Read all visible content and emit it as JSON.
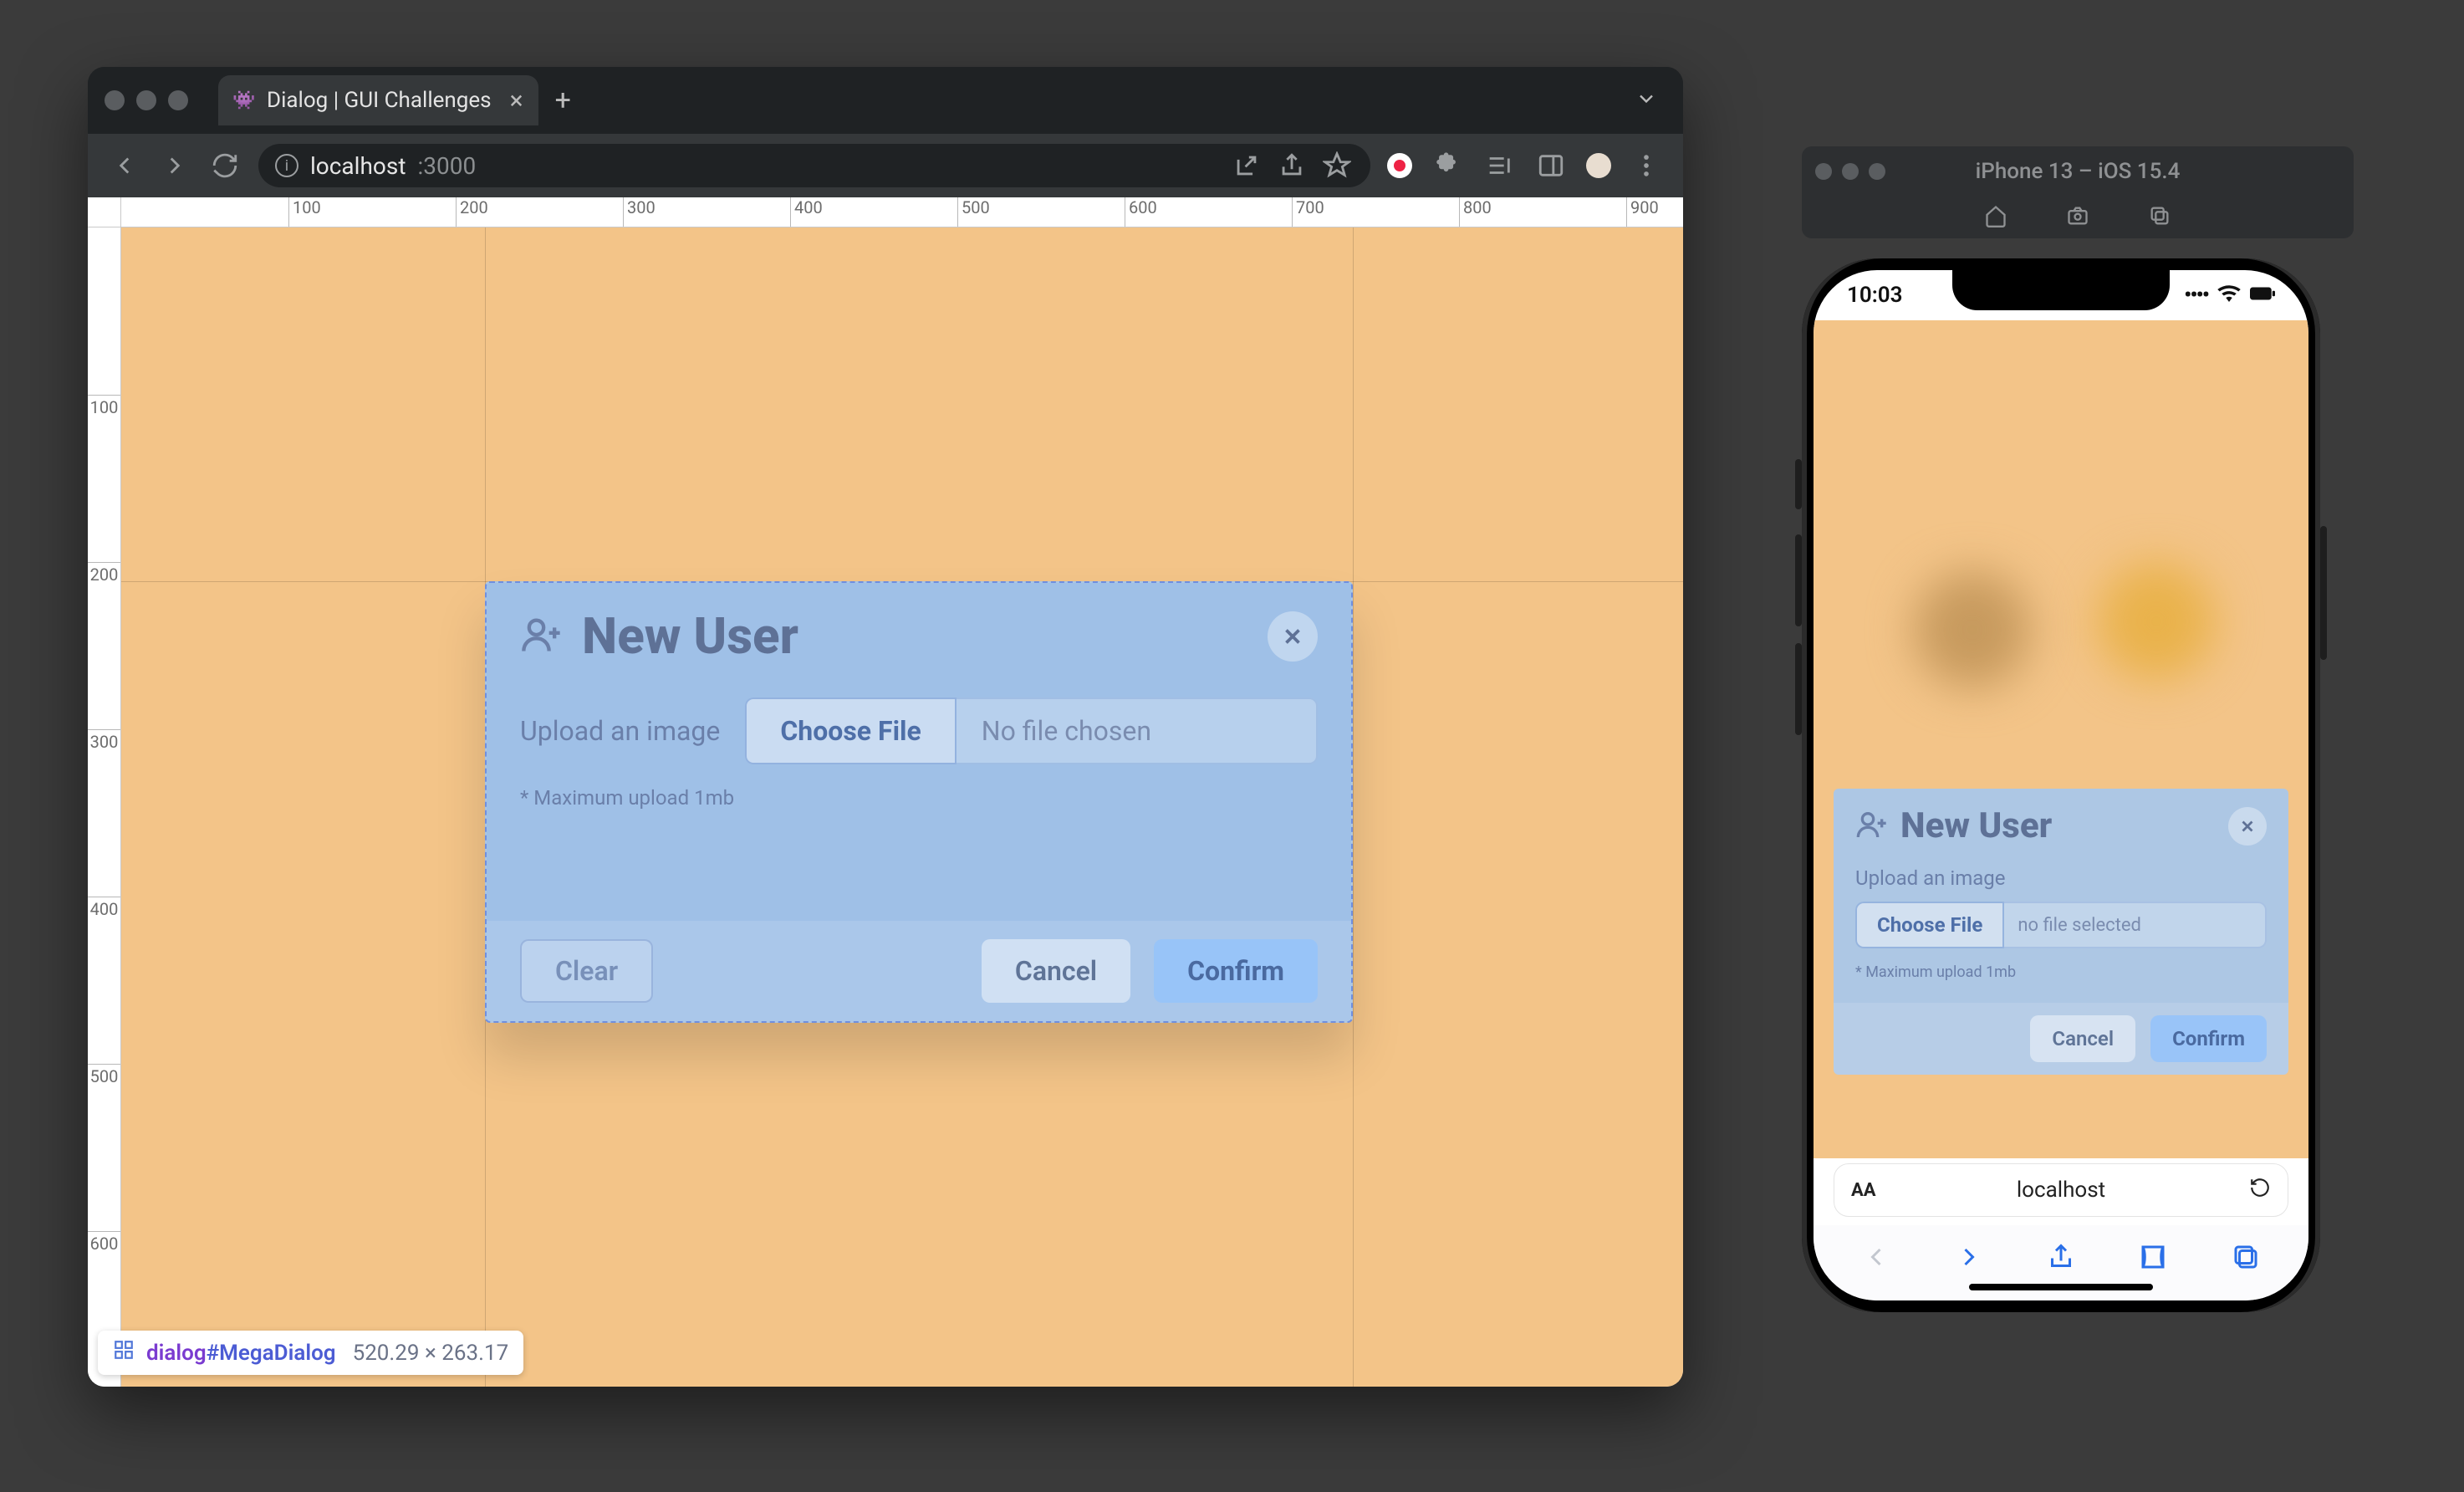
{
  "browser": {
    "tab_title": "Dialog | GUI Challenges",
    "url_host": "localhost",
    "url_port": ":3000",
    "ruler_h": [
      "100",
      "200",
      "300",
      "400",
      "500",
      "600",
      "700",
      "800",
      "900"
    ],
    "ruler_v": [
      "100",
      "200",
      "300",
      "400",
      "500",
      "600"
    ],
    "selector_tag": "dialog",
    "selector_id": "#MegaDialog",
    "selector_dim": "520.29 × 263.17"
  },
  "dialog": {
    "title": "New User",
    "upload_label": "Upload an image",
    "choose_file": "Choose File",
    "no_file": "No file chosen",
    "hint": "* Maximum upload 1mb",
    "clear": "Clear",
    "cancel": "Cancel",
    "confirm": "Confirm"
  },
  "simulator": {
    "title": "iPhone 13 – iOS 15.4",
    "clock": "10:03",
    "url": "localhost"
  },
  "dialog_mobile": {
    "title": "New User",
    "upload_label": "Upload an image",
    "choose_file": "Choose File",
    "no_file": "no file selected",
    "hint": "* Maximum upload 1mb",
    "cancel": "Cancel",
    "confirm": "Confirm"
  }
}
